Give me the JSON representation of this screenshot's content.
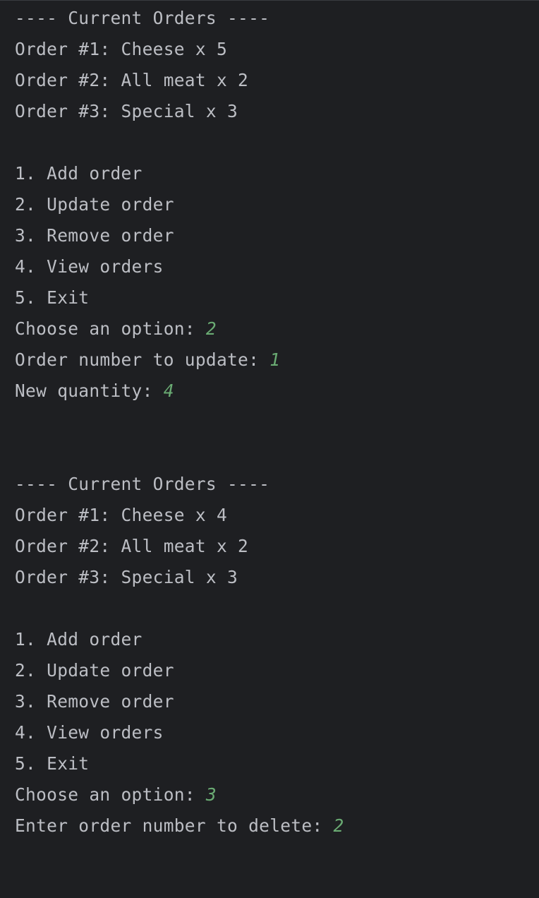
{
  "colors": {
    "background": "#1e1f22",
    "output_text": "#bcbec4",
    "user_input": "#6aab73"
  },
  "session1": {
    "header": "---- Current Orders ----",
    "orders": [
      "Order #1: Cheese x 5",
      "Order #2: All meat x 2",
      "Order #3: Special x 3"
    ],
    "menu": [
      "1. Add order",
      "2. Update order",
      "3. Remove order",
      "4. View orders",
      "5. Exit"
    ],
    "prompts": [
      {
        "label": "Choose an option: ",
        "value": "2"
      },
      {
        "label": "Order number to update: ",
        "value": "1"
      },
      {
        "label": "New quantity: ",
        "value": "4"
      }
    ]
  },
  "session2": {
    "header": "---- Current Orders ----",
    "orders": [
      "Order #1: Cheese x 4",
      "Order #2: All meat x 2",
      "Order #3: Special x 3"
    ],
    "menu": [
      "1. Add order",
      "2. Update order",
      "3. Remove order",
      "4. View orders",
      "5. Exit"
    ],
    "prompts": [
      {
        "label": "Choose an option: ",
        "value": "3"
      },
      {
        "label": "Enter order number to delete: ",
        "value": "2"
      }
    ]
  }
}
